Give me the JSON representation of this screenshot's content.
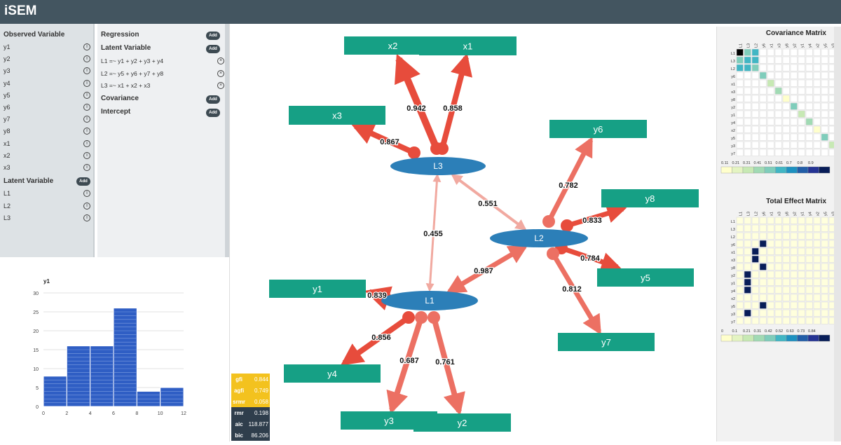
{
  "app": {
    "title": "iSEM"
  },
  "observed": {
    "title": "Observed Variable",
    "items": [
      "y1",
      "y2",
      "y3",
      "y4",
      "y5",
      "y6",
      "y7",
      "y8",
      "x1",
      "x2",
      "x3"
    ]
  },
  "latent": {
    "title": "Latent Variable",
    "add_label": "Add",
    "items": [
      "L1",
      "L2",
      "L3"
    ]
  },
  "model": {
    "regression": {
      "title": "Regression",
      "add_label": "Add"
    },
    "latent": {
      "title": "Latent Variable",
      "add_label": "Add",
      "equations": [
        "L1 =~ y1 + y2 + y3 + y4",
        "L2 =~ y5 + y6 + y7 + y8",
        "L3 =~ x1 + x2 + x3"
      ]
    },
    "covariance": {
      "title": "Covariance",
      "add_label": "Add"
    },
    "intercept": {
      "title": "Intercept",
      "add_label": "Add"
    }
  },
  "icons": {
    "info": "info-icon",
    "remove": "remove-circle-icon"
  },
  "colors": {
    "topbar": "#435560",
    "indicator_box": "#16a085",
    "latent_ellipse": "#2c7fb8",
    "path_strong": "#e74c3c",
    "path_medium": "#ec7063",
    "path_weak": "#f1a9a0",
    "hist_bar": "#2f5ec4",
    "fit_yellow": "#f3c21e",
    "fit_dark": "#2f3e4c"
  },
  "path_diagram": {
    "indicators": [
      "x2",
      "x1",
      "x3",
      "y6",
      "y8",
      "y5",
      "y7",
      "y1",
      "y4",
      "y3",
      "y2"
    ],
    "latents": [
      "L3",
      "L2",
      "L1"
    ],
    "loadings": [
      {
        "from": "L3",
        "to": "x2",
        "value": "0.942"
      },
      {
        "from": "L3",
        "to": "x1",
        "value": "0.858"
      },
      {
        "from": "L3",
        "to": "x3",
        "value": "0.867"
      },
      {
        "from": "L2",
        "to": "y6",
        "value": "0.782"
      },
      {
        "from": "L2",
        "to": "y8",
        "value": "0.833"
      },
      {
        "from": "L2",
        "to": "y5",
        "value": "0.784"
      },
      {
        "from": "L2",
        "to": "y7",
        "value": "0.812"
      },
      {
        "from": "L1",
        "to": "y1",
        "value": "0.839"
      },
      {
        "from": "L1",
        "to": "y4",
        "value": "0.856"
      },
      {
        "from": "L1",
        "to": "y3",
        "value": "0.687"
      },
      {
        "from": "L1",
        "to": "y2",
        "value": "0.761"
      }
    ],
    "covariances": [
      {
        "a": "L3",
        "b": "L2",
        "value": "0.551"
      },
      {
        "a": "L3",
        "b": "L1",
        "value": "0.455"
      },
      {
        "a": "L1",
        "b": "L2",
        "value": "0.987"
      }
    ]
  },
  "fit_indices": [
    {
      "key": "gfi",
      "value": "0.844",
      "style": "yellow"
    },
    {
      "key": "agfi",
      "value": "0.749",
      "style": "yellow"
    },
    {
      "key": "srmr",
      "value": "0.058",
      "style": "yellow"
    },
    {
      "key": "rmr",
      "value": "0.198",
      "style": "dark"
    },
    {
      "key": "aic",
      "value": "118.877",
      "style": "dark"
    },
    {
      "key": "bic",
      "value": "86.206",
      "style": "dark"
    }
  ],
  "covariance_matrix": {
    "title": "Covariance Matrix",
    "cols": [
      "L1",
      "L3",
      "L2",
      "y6",
      "x1",
      "x3",
      "y8",
      "y2",
      "y1",
      "y4",
      "x2",
      "y5",
      "y3",
      "y7"
    ],
    "rows": [
      "L1",
      "L3",
      "L2",
      "y6",
      "x1",
      "x3",
      "y8",
      "y2",
      "y1",
      "y4",
      "x2",
      "y5",
      "y3",
      "y7"
    ],
    "legend_ticks": [
      "0.11",
      "0.21",
      "0.31",
      "0.41",
      "0.51",
      "0.61",
      "0.7",
      "0.8",
      "0.9"
    ],
    "legend_colors": [
      "#ffffcc",
      "#e4f4c2",
      "#c7e9b4",
      "#a1dab4",
      "#7fcdbb",
      "#41b6c4",
      "#1d91c0",
      "#225ea8",
      "#253494",
      "#081d58"
    ]
  },
  "effect_matrix": {
    "title": "Total Effect Matrix",
    "cols": [
      "L1",
      "L3",
      "L2",
      "y6",
      "x1",
      "x3",
      "y8",
      "y2",
      "y1",
      "y4",
      "x2",
      "y5",
      "y3",
      "y7"
    ],
    "rows": [
      "L1",
      "L3",
      "L2",
      "y6",
      "x1",
      "x3",
      "y8",
      "y2",
      "y1",
      "y4",
      "x2",
      "y5",
      "y3",
      "y7"
    ],
    "legend_ticks": [
      "0",
      "0.1",
      "0.21",
      "0.31",
      "0.42",
      "0.52",
      "0.63",
      "0.73",
      "0.84"
    ],
    "legend_colors": [
      "#ffffcc",
      "#e4f4c2",
      "#c7e9b4",
      "#a1dab4",
      "#7fcdbb",
      "#41b6c4",
      "#1d91c0",
      "#225ea8",
      "#253494",
      "#081d58"
    ]
  },
  "chart_data": {
    "type": "bar",
    "title": "y1",
    "x": [
      0,
      2,
      4,
      6,
      8,
      10
    ],
    "bin_width": 2,
    "values": [
      8,
      16,
      16,
      26,
      4,
      5
    ],
    "xlabel": "",
    "ylabel": "",
    "xlim": [
      0,
      12
    ],
    "ylim": [
      0,
      30
    ],
    "xticks": [
      "0",
      "2",
      "4",
      "6",
      "8",
      "10",
      "12"
    ],
    "yticks": [
      "0",
      "5",
      "10",
      "15",
      "20",
      "25",
      "30"
    ],
    "grid": true
  }
}
